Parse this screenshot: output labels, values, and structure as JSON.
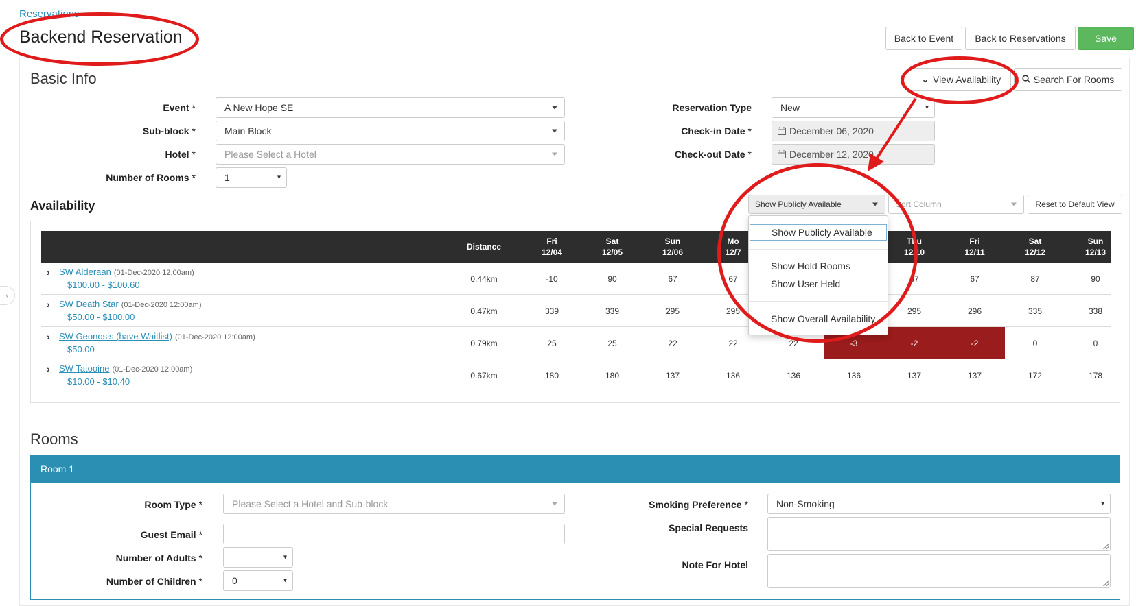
{
  "breadcrumb": "Reservations",
  "page_title": "Backend Reservation",
  "header_buttons": {
    "back_to_event": "Back to Event",
    "back_to_reservations": "Back to Reservations",
    "save": "Save"
  },
  "basic_info": {
    "title": "Basic Info",
    "view_availability": "View Availability",
    "search_for_rooms": "Search For Rooms",
    "fields": {
      "event_label": "Event",
      "event_value": "A New Hope SE",
      "subblock_label": "Sub-block",
      "subblock_value": "Main Block",
      "hotel_label": "Hotel",
      "hotel_placeholder": "Please Select a Hotel",
      "num_rooms_label": "Number of Rooms",
      "num_rooms_value": "1",
      "reservation_type_label": "Reservation Type",
      "reservation_type_value": "New",
      "checkin_label": "Check-in Date",
      "checkin_value": "December 06, 2020",
      "checkout_label": "Check-out Date",
      "checkout_value": "December 12, 2020",
      "required_mark": "*"
    }
  },
  "availability": {
    "title": "Availability",
    "filter_value": "Show Publicly Available",
    "sort_placeholder": "Sort Column",
    "reset_button": "Reset to Default View",
    "filter_menu": [
      "Show Publicly Available",
      "Show Hold Rooms",
      "Show User Held",
      "Show Overall Availability"
    ],
    "columns": [
      {
        "day": "Distance",
        "date": ""
      },
      {
        "day": "Fri",
        "date": "12/04"
      },
      {
        "day": "Sat",
        "date": "12/05"
      },
      {
        "day": "Sun",
        "date": "12/06"
      },
      {
        "day": "Mo",
        "date": "12/7"
      },
      {
        "day": "",
        "date": ""
      },
      {
        "day": "",
        "date": ""
      },
      {
        "day": "Thu",
        "date": "12/10"
      },
      {
        "day": "Fri",
        "date": "12/11"
      },
      {
        "day": "Sat",
        "date": "12/12"
      },
      {
        "day": "Sun",
        "date": "12/13"
      }
    ],
    "rows": [
      {
        "name": "SW Alderaan",
        "date": "(01-Dec-2020 12:00am)",
        "price": "$100.00 - $100.60",
        "distance": "0.44km",
        "values": [
          "-10",
          "90",
          "67",
          "67",
          "",
          "",
          "67",
          "67",
          "87",
          "90"
        ]
      },
      {
        "name": "SW Death Star",
        "date": "(01-Dec-2020 12:00am)",
        "price": "$50.00 - $100.00",
        "distance": "0.47km",
        "values": [
          "339",
          "339",
          "295",
          "295",
          "",
          "",
          "295",
          "296",
          "335",
          "338"
        ]
      },
      {
        "name": "SW Geonosis (have Waitlist)",
        "date": "(01-Dec-2020 12:00am)",
        "price": "$50.00",
        "distance": "0.79km",
        "values": [
          "25",
          "25",
          "22",
          "22",
          "22",
          "-3",
          "-2",
          "-2",
          "0",
          "0"
        ]
      },
      {
        "name": "SW Tatooine",
        "date": "(01-Dec-2020 12:00am)",
        "price": "$10.00 - $10.40",
        "distance": "0.67km",
        "values": [
          "180",
          "180",
          "137",
          "136",
          "136",
          "136",
          "137",
          "137",
          "172",
          "178"
        ]
      }
    ]
  },
  "rooms": {
    "title": "Rooms",
    "room_header": "Room 1",
    "room_type_label": "Room Type",
    "room_type_placeholder": "Please Select a Hotel and Sub-block",
    "guest_email_label": "Guest Email",
    "adults_label": "Number of Adults",
    "children_label": "Number of Children",
    "children_value": "0",
    "smoking_label": "Smoking Preference",
    "smoking_value": "Non-Smoking",
    "special_requests_label": "Special Requests",
    "note_label": "Note For Hotel"
  },
  "colors": {
    "accent": "#2b8fb3",
    "success": "#5cb85c",
    "negative_cell": "#9b1c1c",
    "annotation": "#e01b1b"
  }
}
